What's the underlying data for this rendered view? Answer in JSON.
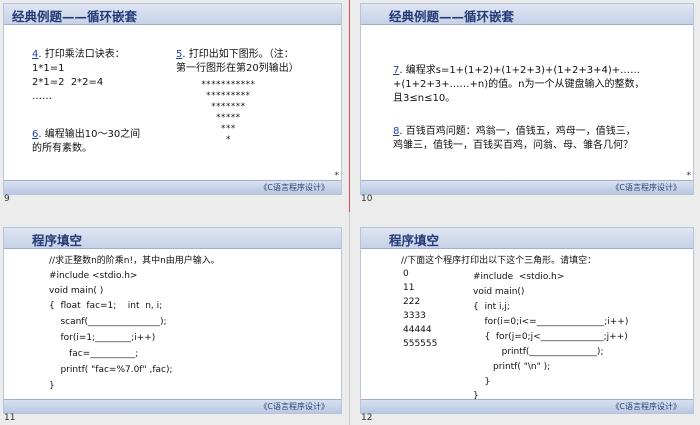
{
  "slide_title_loops": "经典例题——循环嵌套",
  "slide_title_fill": "程序填空",
  "footer": "《C语言程序设计》",
  "star": "*",
  "slides": {
    "s9": {
      "num": "9",
      "q4_num": "4",
      "q4_text": ". 打印乘法口诀表：",
      "q4_l1": "1*1=1",
      "q4_l2": "2*1=2  2*2=4",
      "q4_l3": "……",
      "q5_num": "5",
      "q5_text": ". 打印出如下图形。（注：",
      "q5_text2": "第一行图形在第20列输出）",
      "tri": [
        "***********",
        " *********",
        "  *******",
        "   *****",
        "    ***",
        "     *"
      ],
      "q6_num": "6",
      "q6_text": ". 编程输出10～30之间",
      "q6_text2": "的所有素数。"
    },
    "s10": {
      "num": "10",
      "q7_num": "7",
      "q7_text": ". 编程求s=1+(1+2)+(1+2+3)+(1+2+3+4)+……",
      "q7_text2": "+(1+2+3+……+n)的值。n为一个从键盘输入的整数，",
      "q7_text3": "且3≤n≤10。",
      "q8_num": "8",
      "q8_text": ". 百钱百鸡问题：鸡翁一，值钱五，鸡母一，值钱三，",
      "q8_text2": "鸡雏三，值钱一，百钱买百鸡，问翁、母、雏各几何？"
    },
    "s11": {
      "num": "11",
      "lines": [
        "//求正整数n的阶乘n!，其中n由用户输入。",
        "#include <stdio.h>",
        "void main( )",
        "{  float  fac=1;    int  n, i;",
        "    scanf(________________);",
        "    for(i=1;________;i++)",
        "       fac=__________;",
        "    printf( \"fac=%7.0f\" ,fac);",
        "}"
      ]
    },
    "s12": {
      "num": "12",
      "header": "//下面这个程序打印出以下这个三角形。请填空：",
      "nums": [
        "0",
        "11",
        "222",
        "3333",
        "44444",
        "555555"
      ],
      "code": [
        "#include  <stdio.h>",
        "void main()",
        "{  int i,j;",
        "    for(i=0;i<=_______________;i++)",
        "    {  for(j=0;j<______________;j++)",
        "          printf(_______________);",
        "       printf( \"\\n\" );",
        "    }",
        "}"
      ]
    }
  }
}
